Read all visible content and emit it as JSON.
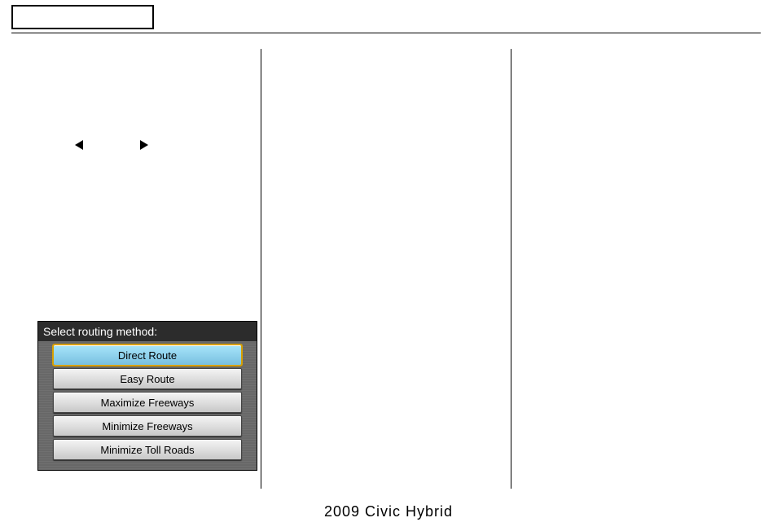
{
  "header": {
    "button_label": ""
  },
  "col1": {
    "screenshot_title": "Select routing method:",
    "routes": [
      {
        "label": "Direct Route",
        "selected": true
      },
      {
        "label": "Easy Route",
        "selected": false
      },
      {
        "label": "Maximize Freeways",
        "selected": false
      },
      {
        "label": "Minimize Freeways",
        "selected": false
      },
      {
        "label": "Minimize Toll Roads",
        "selected": false
      }
    ]
  },
  "footer": {
    "text": "2009  Civic  Hybrid"
  }
}
